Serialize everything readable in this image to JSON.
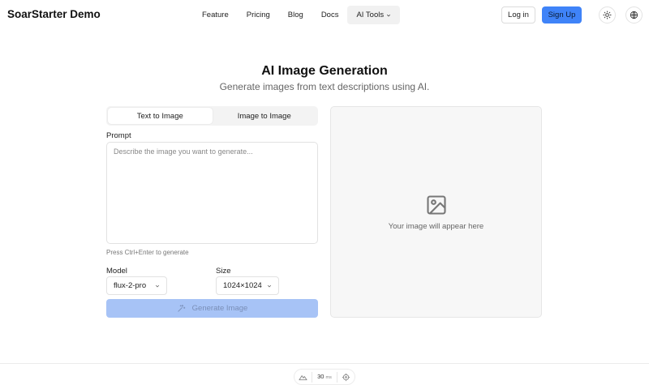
{
  "header": {
    "brand": "SoarStarter Demo",
    "nav": [
      "Feature",
      "Pricing",
      "Blog",
      "Docs"
    ],
    "ai_tools": "AI Tools",
    "login": "Log in",
    "signup": "Sign Up",
    "theme_icon": "sun-icon",
    "language_icon": "globe-icon"
  },
  "page": {
    "title": "AI Image Generation",
    "subtitle": "Generate images from text descriptions using AI."
  },
  "form": {
    "tabs": [
      "Text to Image",
      "Image to Image"
    ],
    "active_tab": "Text to Image",
    "prompt_label": "Prompt",
    "prompt_placeholder": "Describe the image you want to generate...",
    "prompt_value": "",
    "hint": "Press Ctrl+Enter to generate",
    "model_label": "Model",
    "model_value": "flux-2-pro",
    "size_label": "Size",
    "size_value": "1024×1024",
    "generate": "Generate Image"
  },
  "preview": {
    "icon": "image-icon",
    "text": "Your image will appear here"
  },
  "devbar": {
    "ms_value": "30",
    "ms_unit": "ms"
  },
  "colors": {
    "accent": "#3f83f8",
    "accent_disabled": "#a7c3f6"
  }
}
